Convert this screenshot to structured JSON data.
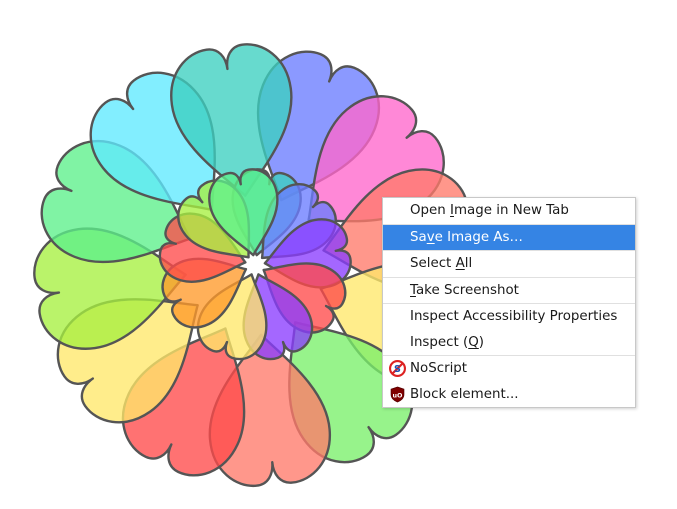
{
  "image": {
    "colors": {
      "cyan": "#5fe9ff",
      "blue": "#6a7cff",
      "magenta": "#ff66cc",
      "salmon": "#ff7a6a",
      "green": "#5cf08a",
      "lime": "#a6f040",
      "yellow": "#ffe86a",
      "red": "#ff4a4a",
      "orange": "#ff9a2a",
      "purple": "#8a3cff",
      "teal": "#3cd0c0",
      "mint": "#7af06a",
      "outline": "#555555"
    }
  },
  "context_menu": {
    "items": [
      {
        "pre": "Open ",
        "key": "I",
        "post": "mage in New Tab",
        "active": false
      },
      {
        "pre": "Sa",
        "key": "v",
        "post": "e Image As…",
        "active": true
      },
      {
        "pre": "Select ",
        "key": "A",
        "post": "ll",
        "active": false
      },
      {
        "pre": "",
        "key": "T",
        "post": "ake Screenshot",
        "active": false
      },
      {
        "pre": "Inspect Accessibility Properties",
        "key": "",
        "post": "",
        "active": false
      },
      {
        "pre": "Inspect (",
        "key": "Q",
        "post": ")",
        "active": false
      },
      {
        "label": "NoScript",
        "icon": "noscript-icon"
      },
      {
        "label": "Block element...",
        "icon": "ublock-icon"
      }
    ],
    "highlight_color": "#3584e4"
  }
}
